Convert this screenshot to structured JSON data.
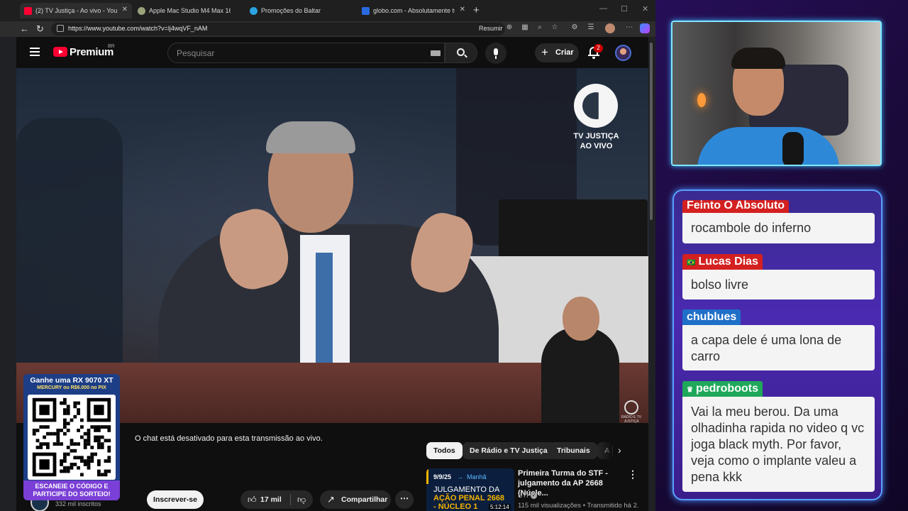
{
  "browser": {
    "tabs": [
      {
        "label": "(2) TV Justiça - Ao vivo - YouTube",
        "active": true,
        "color": "#ff0033"
      },
      {
        "label": "Apple Mac Studio M4 Max 16-core",
        "active": false,
        "color": "#9aa27a"
      },
      {
        "label": "Promoções do Baltar",
        "active": false,
        "color": "#2aa3e0"
      },
      {
        "label": "globo.com - Absolutamente tudo",
        "active": false,
        "color": "#2a6ae0"
      }
    ],
    "url": "https://www.youtube.com/watch?v=lj4wqVF_nAM",
    "resumir_label": "Resumir"
  },
  "youtube": {
    "brand": "Premium",
    "region": "BR",
    "search_placeholder": "Pesquisar",
    "create_label": "Criar",
    "notification_count": "2"
  },
  "video": {
    "logo_line1": "TV JUSTIÇA",
    "logo_line2": "AO VIVO",
    "small_logo_text": "RÁDIO E TV JUSTIÇA"
  },
  "watch": {
    "chat_disabled": "O chat está desativado para esta transmissão ao vivo.",
    "channel_name_partial": "a",
    "subscribers": "332 mil inscritos",
    "subscribe_label": "Inscrever-se",
    "likes": "17 mil",
    "share_label": "Compartilhar",
    "chips": [
      "Todos",
      "De Rádio e TV Justiça",
      "Tribunais",
      "A"
    ]
  },
  "recommendation": {
    "thumb_date": "9/9/25",
    "thumb_shift": "Manhã",
    "thumb_line1": "JULGAMENTO DA",
    "thumb_line2": "AÇÃO PENAL 2668",
    "thumb_line3": "- NÚCLEO 1",
    "thumb_duration": "5:12:14",
    "title": "Primeira Turma do STF - julgamento da AP 2668 (Núcle...",
    "channel": "STF",
    "meta": "115 mil visualizações • Transmitido há 2..."
  },
  "promo": {
    "title": "Ganhe uma RX 9070 XT",
    "subtitle": "MERCURY ou R$6.000 no PIX",
    "cta1": "ESCANEIE O CÓDIGO E",
    "cta2": "PARTICIPE DO SORTEIO!"
  },
  "chat": {
    "messages": [
      {
        "user": "Feinto O Absoluto",
        "badge": "",
        "name_color": "#d42020",
        "text": "rocambole do inferno"
      },
      {
        "user": "Lucas Dias",
        "badge": "🇧🇷",
        "name_color": "#d42020",
        "text": "bolso livre"
      },
      {
        "user": "chublues",
        "badge": "",
        "name_color": "#1f6fc8",
        "text": "a capa dele é uma lona de carro"
      },
      {
        "user": "pedroboots",
        "badge": "♛",
        "name_color": "#1fa85a",
        "text": "Vai la meu berou. Da uma olhadinha rapida no video q vc joga black myth. Por favor, veja como o implante valeu a pena kkk"
      }
    ]
  }
}
